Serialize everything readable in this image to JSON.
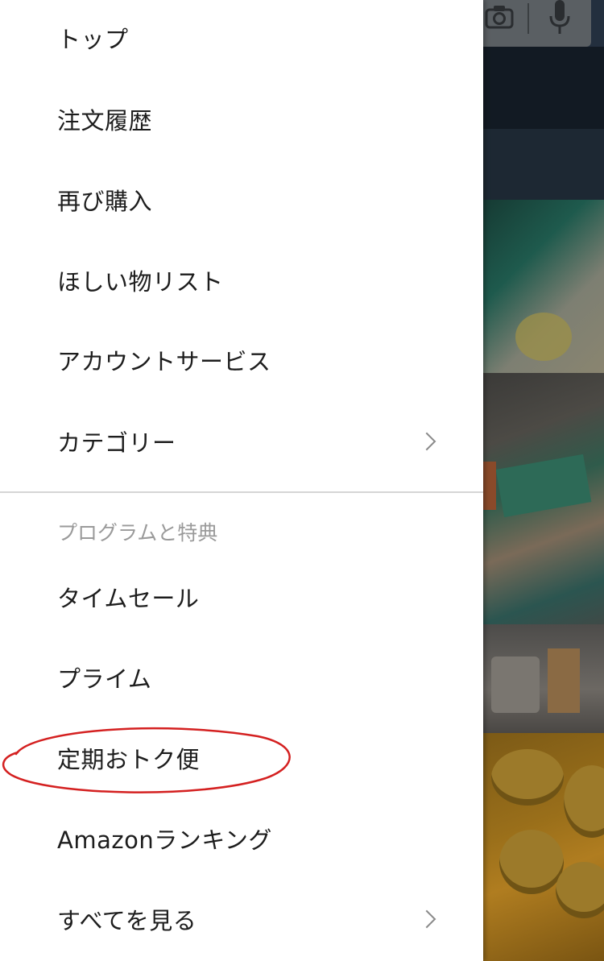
{
  "menu": {
    "items_top": [
      {
        "label": "トップ",
        "has_chevron": false
      },
      {
        "label": "注文履歴",
        "has_chevron": false
      },
      {
        "label": "再び購入",
        "has_chevron": false
      },
      {
        "label": "ほしい物リスト",
        "has_chevron": false
      },
      {
        "label": "アカウントサービス",
        "has_chevron": false
      },
      {
        "label": "カテゴリー",
        "has_chevron": true
      }
    ],
    "section_header": "プログラムと特典",
    "items_programs": [
      {
        "label": "タイムセール",
        "has_chevron": false
      },
      {
        "label": "プライム",
        "has_chevron": false
      },
      {
        "label": "定期おトク便",
        "has_chevron": false,
        "highlighted": true
      },
      {
        "label": "Amazonランキング",
        "has_chevron": false
      },
      {
        "label": "すべてを見る",
        "has_chevron": true
      }
    ]
  },
  "icons": {
    "camera": "camera-icon",
    "microphone": "microphone-icon",
    "chevron": "chevron-right-icon"
  },
  "colors": {
    "drawer_bg": "#ffffff",
    "menu_text": "#1d1d1d",
    "section_header_text": "#9a9a9a",
    "annotation_ellipse": "#d42020"
  }
}
